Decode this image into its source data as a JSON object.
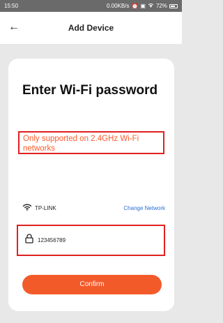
{
  "status_bar": {
    "time": "15:50",
    "network_speed": "0.00KB/s",
    "battery": "72%"
  },
  "header": {
    "back_icon": "arrow-left-icon",
    "title": "Add Device"
  },
  "card": {
    "heading": "Enter Wi-Fi password",
    "notice": "Only supported on 2.4GHz Wi-Fi networks",
    "wifi": {
      "icon": "wifi-icon",
      "ssid": "TP-LINK",
      "change_label": "Change Network"
    },
    "password": {
      "icon": "lock-icon",
      "value": "123456789"
    },
    "confirm_label": "Confirm"
  },
  "colors": {
    "accent": "#f35a2a",
    "link": "#2a6fd6",
    "highlight_border": "#e02020"
  }
}
